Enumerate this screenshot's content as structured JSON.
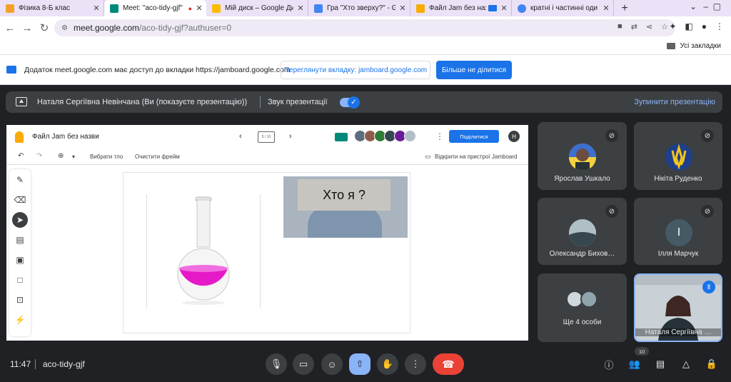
{
  "browser": {
    "tabs": [
      {
        "title": "Фізика 8-Б клас",
        "fav_color": "#f4a12b",
        "active": false
      },
      {
        "title": "Meet: \"aco-tidy-gjf\"",
        "fav_color": "#00897b",
        "active": true,
        "recording": "●"
      },
      {
        "title": "Мій диск – Google Ди",
        "fav_color": "#fbbc04",
        "active": false
      },
      {
        "title": "Гра \"Хто зверху?\" - Go",
        "fav_color": "#4285f4",
        "active": false
      },
      {
        "title": "Файл Jam без наз",
        "fav_color": "#f9ab00",
        "active": false
      },
      {
        "title": "кратні і частинні оди",
        "fav_color": "#4285f4",
        "active": false
      }
    ],
    "new_tab": "+",
    "url_host": "meet.google.com",
    "url_path": "/aco-tidy-gjf?authuser=0",
    "bookmarks_all": "Усі закладки"
  },
  "share_banner": {
    "text": "Додаток meet.google.com має доступ до вкладки https://jamboard.google.com",
    "view_button": "Переглянути вкладку: jamboard.google.com",
    "stop_button": "Більше не ділитися"
  },
  "present_bar": {
    "presenter": "Наталя Сергіївна Невінчана (Ви (показуєте презентацію))",
    "sound_label": "Звук презентації",
    "toggle_mark": "✓",
    "stop_label": "Зупинити презентацію"
  },
  "jam": {
    "title": "Файл Jam без назви",
    "frame_counter": "5 / 10",
    "share_label": "Поділитися",
    "user_initial": "Н",
    "toolbar": {
      "set_background": "Вибрати тло",
      "clear_frame": "Очистити фрейм",
      "open_device": "Відкрити на пристрої Jamboard"
    },
    "poster_text": "Хто я ?"
  },
  "participants": [
    {
      "name": "Ярослав Ушкало",
      "muted": true
    },
    {
      "name": "Нікіта Руденко",
      "muted": true
    },
    {
      "name": "Олександр Бихов…",
      "muted": true
    },
    {
      "name": "Ілля Марчук",
      "muted": true,
      "initial": "І"
    },
    {
      "name": "Ще 4 особи"
    },
    {
      "name": "Наталя Сергіївна …",
      "speaking": true
    }
  ],
  "bottom": {
    "time": "11:47",
    "meeting_code": "aco-tidy-gjf",
    "participant_count": "10"
  }
}
